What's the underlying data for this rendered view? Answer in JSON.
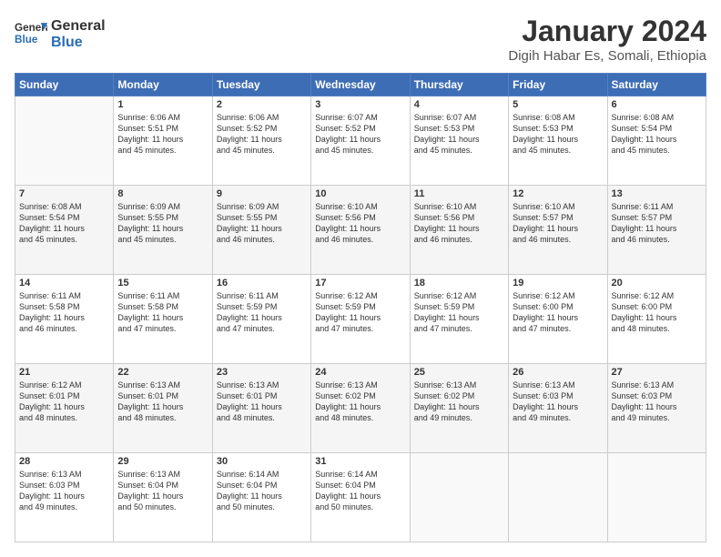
{
  "logo": {
    "line1": "General",
    "line2": "Blue"
  },
  "title": "January 2024",
  "subtitle": "Digih Habar Es, Somali, Ethiopia",
  "days_header": [
    "Sunday",
    "Monday",
    "Tuesday",
    "Wednesday",
    "Thursday",
    "Friday",
    "Saturday"
  ],
  "weeks": [
    [
      {
        "num": "",
        "info": ""
      },
      {
        "num": "1",
        "info": "Sunrise: 6:06 AM\nSunset: 5:51 PM\nDaylight: 11 hours\nand 45 minutes."
      },
      {
        "num": "2",
        "info": "Sunrise: 6:06 AM\nSunset: 5:52 PM\nDaylight: 11 hours\nand 45 minutes."
      },
      {
        "num": "3",
        "info": "Sunrise: 6:07 AM\nSunset: 5:52 PM\nDaylight: 11 hours\nand 45 minutes."
      },
      {
        "num": "4",
        "info": "Sunrise: 6:07 AM\nSunset: 5:53 PM\nDaylight: 11 hours\nand 45 minutes."
      },
      {
        "num": "5",
        "info": "Sunrise: 6:08 AM\nSunset: 5:53 PM\nDaylight: 11 hours\nand 45 minutes."
      },
      {
        "num": "6",
        "info": "Sunrise: 6:08 AM\nSunset: 5:54 PM\nDaylight: 11 hours\nand 45 minutes."
      }
    ],
    [
      {
        "num": "7",
        "info": "Sunrise: 6:08 AM\nSunset: 5:54 PM\nDaylight: 11 hours\nand 45 minutes."
      },
      {
        "num": "8",
        "info": "Sunrise: 6:09 AM\nSunset: 5:55 PM\nDaylight: 11 hours\nand 45 minutes."
      },
      {
        "num": "9",
        "info": "Sunrise: 6:09 AM\nSunset: 5:55 PM\nDaylight: 11 hours\nand 46 minutes."
      },
      {
        "num": "10",
        "info": "Sunrise: 6:10 AM\nSunset: 5:56 PM\nDaylight: 11 hours\nand 46 minutes."
      },
      {
        "num": "11",
        "info": "Sunrise: 6:10 AM\nSunset: 5:56 PM\nDaylight: 11 hours\nand 46 minutes."
      },
      {
        "num": "12",
        "info": "Sunrise: 6:10 AM\nSunset: 5:57 PM\nDaylight: 11 hours\nand 46 minutes."
      },
      {
        "num": "13",
        "info": "Sunrise: 6:11 AM\nSunset: 5:57 PM\nDaylight: 11 hours\nand 46 minutes."
      }
    ],
    [
      {
        "num": "14",
        "info": "Sunrise: 6:11 AM\nSunset: 5:58 PM\nDaylight: 11 hours\nand 46 minutes."
      },
      {
        "num": "15",
        "info": "Sunrise: 6:11 AM\nSunset: 5:58 PM\nDaylight: 11 hours\nand 47 minutes."
      },
      {
        "num": "16",
        "info": "Sunrise: 6:11 AM\nSunset: 5:59 PM\nDaylight: 11 hours\nand 47 minutes."
      },
      {
        "num": "17",
        "info": "Sunrise: 6:12 AM\nSunset: 5:59 PM\nDaylight: 11 hours\nand 47 minutes."
      },
      {
        "num": "18",
        "info": "Sunrise: 6:12 AM\nSunset: 5:59 PM\nDaylight: 11 hours\nand 47 minutes."
      },
      {
        "num": "19",
        "info": "Sunrise: 6:12 AM\nSunset: 6:00 PM\nDaylight: 11 hours\nand 47 minutes."
      },
      {
        "num": "20",
        "info": "Sunrise: 6:12 AM\nSunset: 6:00 PM\nDaylight: 11 hours\nand 48 minutes."
      }
    ],
    [
      {
        "num": "21",
        "info": "Sunrise: 6:12 AM\nSunset: 6:01 PM\nDaylight: 11 hours\nand 48 minutes."
      },
      {
        "num": "22",
        "info": "Sunrise: 6:13 AM\nSunset: 6:01 PM\nDaylight: 11 hours\nand 48 minutes."
      },
      {
        "num": "23",
        "info": "Sunrise: 6:13 AM\nSunset: 6:01 PM\nDaylight: 11 hours\nand 48 minutes."
      },
      {
        "num": "24",
        "info": "Sunrise: 6:13 AM\nSunset: 6:02 PM\nDaylight: 11 hours\nand 48 minutes."
      },
      {
        "num": "25",
        "info": "Sunrise: 6:13 AM\nSunset: 6:02 PM\nDaylight: 11 hours\nand 49 minutes."
      },
      {
        "num": "26",
        "info": "Sunrise: 6:13 AM\nSunset: 6:03 PM\nDaylight: 11 hours\nand 49 minutes."
      },
      {
        "num": "27",
        "info": "Sunrise: 6:13 AM\nSunset: 6:03 PM\nDaylight: 11 hours\nand 49 minutes."
      }
    ],
    [
      {
        "num": "28",
        "info": "Sunrise: 6:13 AM\nSunset: 6:03 PM\nDaylight: 11 hours\nand 49 minutes."
      },
      {
        "num": "29",
        "info": "Sunrise: 6:13 AM\nSunset: 6:04 PM\nDaylight: 11 hours\nand 50 minutes."
      },
      {
        "num": "30",
        "info": "Sunrise: 6:14 AM\nSunset: 6:04 PM\nDaylight: 11 hours\nand 50 minutes."
      },
      {
        "num": "31",
        "info": "Sunrise: 6:14 AM\nSunset: 6:04 PM\nDaylight: 11 hours\nand 50 minutes."
      },
      {
        "num": "",
        "info": ""
      },
      {
        "num": "",
        "info": ""
      },
      {
        "num": "",
        "info": ""
      }
    ]
  ]
}
